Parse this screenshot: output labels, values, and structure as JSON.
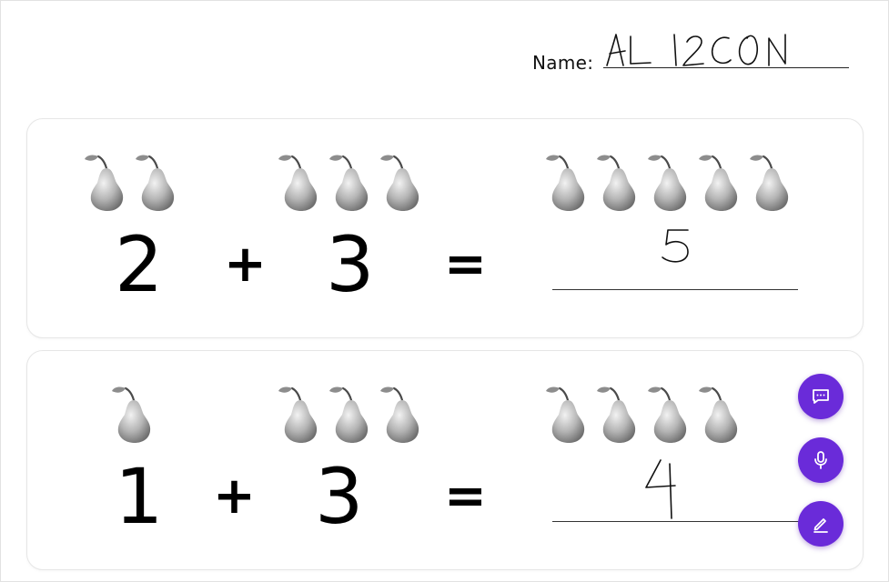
{
  "header": {
    "name_label": "Name:",
    "name_value": "ALIZON"
  },
  "problems": [
    {
      "left_count": 2,
      "operator": "+",
      "right_count": 3,
      "equals": "=",
      "answer_count": 5,
      "left_numeral": "2",
      "right_numeral": "3",
      "handwritten_answer": "5"
    },
    {
      "left_count": 1,
      "operator": "+",
      "right_count": 3,
      "equals": "=",
      "answer_count": 4,
      "left_numeral": "1",
      "right_numeral": "3",
      "handwritten_answer": "4"
    }
  ],
  "toolbar": {
    "buttons": [
      {
        "name": "comment",
        "icon": "chat-bubble-icon"
      },
      {
        "name": "microphone",
        "icon": "microphone-icon"
      },
      {
        "name": "pen",
        "icon": "pencil-icon"
      }
    ]
  },
  "colors": {
    "accent": "#6a2bd9",
    "pear": "#9a9a9a"
  }
}
